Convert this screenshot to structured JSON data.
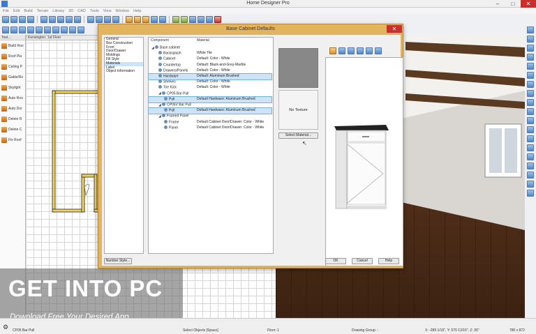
{
  "app": {
    "title": "Home Designer Pro",
    "min": "–",
    "max": "□",
    "close": "✕"
  },
  "menu": [
    "File",
    "Edit",
    "Build",
    "Terrain",
    "Library",
    "3D",
    "CAD",
    "Tools",
    "View",
    "Window",
    "Help"
  ],
  "library": {
    "header": "Tool…",
    "items": [
      "Build Roo",
      "Roof Pla",
      "Ceiling P",
      "Gable/Ro",
      "Skylight",
      "Auto Roo",
      "Auto Dor",
      "Delete R",
      "Delete C",
      "Fix Roof"
    ]
  },
  "plan_tab": "Kensington: 1st Floor",
  "dialog": {
    "title": "Base Cabinet Defaults",
    "close": "✕",
    "categories": [
      "General",
      "Box Construction",
      "Front",
      "Door/Drawer",
      "Moldings",
      "Fill Style",
      "Materials",
      "Label",
      "Object Information"
    ],
    "selected_category": "Materials",
    "col_component": "Component",
    "col_material": "Material",
    "rows": [
      {
        "component": "Base cabinet",
        "material": "",
        "level": 0,
        "expander": "◢"
      },
      {
        "component": "Backsplash",
        "material": "White Tile",
        "level": 1
      },
      {
        "component": "Cabinet",
        "material": "Default: Color - White",
        "level": 1
      },
      {
        "component": "Countertop",
        "material": "Default: Black-and-Grey-Marble",
        "level": 1
      },
      {
        "component": "Drawers/Panels",
        "material": "Default: Color - White",
        "level": 1
      },
      {
        "component": "Hardware",
        "material": "Default: Aluminum Brushed",
        "level": 1,
        "selected": true
      },
      {
        "component": "Shelves",
        "material": "Default: Color - White",
        "level": 1
      },
      {
        "component": "Toe Kick",
        "material": "Default: Color - White",
        "level": 1
      },
      {
        "component": "CP05 Bar Pull",
        "material": "",
        "level": 1,
        "expander": "◢"
      },
      {
        "component": "Pull",
        "material": "Default Hardware: Aluminum Brushed",
        "level": 2,
        "selected": true
      },
      {
        "component": "CP05V Bar Pull",
        "material": "",
        "level": 1,
        "expander": "◢"
      },
      {
        "component": "Pull",
        "material": "Default Hardware: Aluminum Brushed",
        "level": 2,
        "selected": true
      },
      {
        "component": "Framed Panel",
        "material": "",
        "level": 1,
        "expander": "◢"
      },
      {
        "component": "Frame",
        "material": "Default Cabinet Door/Drawer: Color - White",
        "level": 2
      },
      {
        "component": "Panel",
        "material": "Default Cabinet Door/Drawer: Color - White",
        "level": 2
      }
    ],
    "no_texture": "No Texture",
    "select_material": "Select Material...",
    "number_style": "Number Style...",
    "ok": "OK",
    "cancel": "Cancel",
    "help": "Help"
  },
  "status": {
    "left": "CP05 Bar Pull",
    "mode": "Select Objects [Space]",
    "floor": "Floor: 1",
    "group": "Drawing Group: -",
    "coords": "X: -289 1/16\", Y: 570 13/16\", Z: 36\"",
    "size": "780 x 872"
  },
  "watermark": {
    "title": "GET INTO PC",
    "subtitle": "Download Free Your Desired App"
  }
}
